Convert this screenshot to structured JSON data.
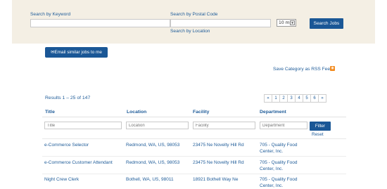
{
  "search": {
    "keyword_label": "Search by Keyword",
    "keyword_value": "",
    "postal_label": "Search by Postal Code",
    "postal_value": "",
    "radius_value": "10 mi",
    "location_label": "Search by Location",
    "search_button": "Search Jobs"
  },
  "actions": {
    "email_button": "Email similar jobs to me",
    "rss_link": "Save Category as RSS Feed"
  },
  "results": {
    "count_text": "Results 1 – 25 of 147",
    "pager": [
      "«",
      "1",
      "2",
      "3",
      "4",
      "5",
      "6",
      "»"
    ]
  },
  "table": {
    "headers": {
      "title": "Title",
      "location": "Location",
      "facility": "Facility",
      "department": "Department"
    },
    "filters": {
      "title_placeholder": "Title",
      "location_placeholder": "Location",
      "facility_placeholder": "Facility",
      "department_placeholder": "Department",
      "filter_button": "Filter",
      "reset_link": "Reset"
    },
    "rows": [
      {
        "title": "e-Commerce Selector",
        "location": "Redmond, WA, US, 98053",
        "facility": "23475 Ne Novelty Hill Rd",
        "department_line1": "705 - Quality Food",
        "department_line2": "Center, Inc."
      },
      {
        "title": "e-Commerce Customer Attendant",
        "location": "Redmond, WA, US, 98053",
        "facility": "23475 Ne Novelty Hill Rd",
        "department_line1": "705 - Quality Food",
        "department_line2": "Center, Inc."
      },
      {
        "title": "Night Crew Clerk",
        "location": "Bothell, WA, US, 98011",
        "facility": "18921 Bothell Way Ne",
        "department_line1": "705 - Quality Food",
        "department_line2": "Center, Inc."
      }
    ]
  },
  "colors": {
    "accent": "#1a5796",
    "link": "#1f5c99",
    "panel_bg": "#f4efe4",
    "rss": "#f28a1d"
  }
}
